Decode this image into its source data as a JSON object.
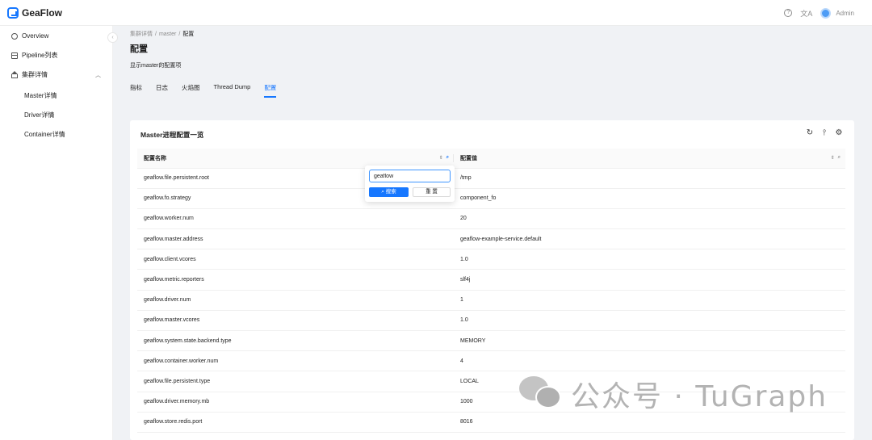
{
  "app": {
    "name": "GeaFlow",
    "user": "Admin",
    "lang_icon": "文A"
  },
  "sidebar": {
    "items": [
      {
        "label": "Overview",
        "icon": "smile-icon"
      },
      {
        "label": "Pipeline列表",
        "icon": "table-icon"
      },
      {
        "label": "集群详情",
        "icon": "home-icon",
        "expanded": true
      }
    ],
    "sub_items": [
      "Master详情",
      "Driver详情",
      "Container详情"
    ]
  },
  "breadcrumb": [
    "集群详情",
    "master",
    "配置"
  ],
  "page": {
    "title": "配置",
    "description": "显示master的配置项"
  },
  "tabs": [
    {
      "label": "指标",
      "active": false
    },
    {
      "label": "日志",
      "active": false
    },
    {
      "label": "火焰图",
      "active": false
    },
    {
      "label": "Thread Dump",
      "active": false
    },
    {
      "label": "配置",
      "active": true
    }
  ],
  "card": {
    "title": "Master进程配置一览",
    "columns": [
      "配置名称",
      "配置值"
    ],
    "rows": [
      [
        "geaflow.file.persistent.root",
        "/tmp"
      ],
      [
        "geaflow.fo.strategy",
        "component_fo"
      ],
      [
        "geaflow.worker.num",
        "20"
      ],
      [
        "geaflow.master.address",
        "geaflow-example-service.default"
      ],
      [
        "geaflow.client.vcores",
        "1.0"
      ],
      [
        "geaflow.metric.reporters",
        "slf4j"
      ],
      [
        "geaflow.driver.num",
        "1"
      ],
      [
        "geaflow.master.vcores",
        "1.0"
      ],
      [
        "geaflow.system.state.backend.type",
        "MEMORY"
      ],
      [
        "geaflow.container.worker.num",
        "4"
      ],
      [
        "geaflow.file.persistent.type",
        "LOCAL"
      ],
      [
        "geaflow.driver.memory.mb",
        "1000"
      ],
      [
        "geaflow.store.redis.port",
        "8016"
      ]
    ]
  },
  "filter": {
    "value": "geaflow",
    "search_label": "搜索",
    "reset_label": "重 置"
  },
  "watermark": {
    "text": "公众号 · TuGraph"
  },
  "colors": {
    "accent": "#1677ff",
    "background": "#f0f2f5"
  }
}
